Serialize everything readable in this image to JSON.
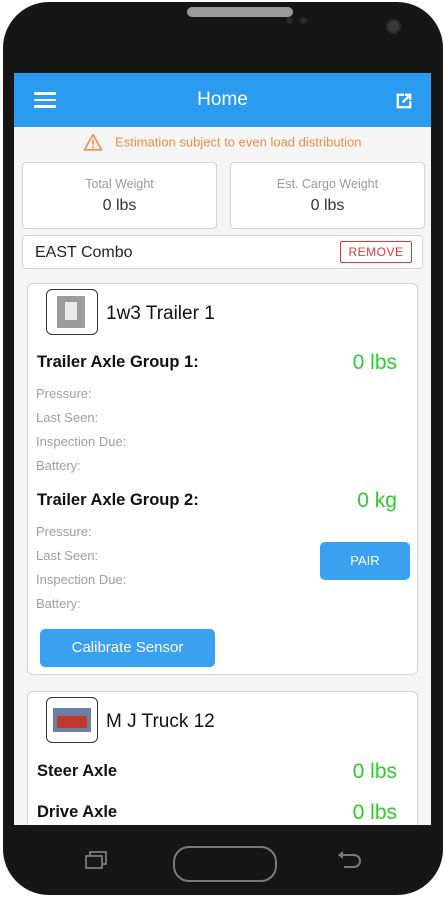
{
  "appbar": {
    "title": "Home",
    "menu_icon": "menu-icon",
    "share_icon": "open-external-icon",
    "color": "#2b9bf0"
  },
  "notice": {
    "text": "Estimation subject to even load distribution",
    "icon": "warning-icon",
    "color": "#f08c45"
  },
  "stats": {
    "total_weight": {
      "label": "Total Weight",
      "value": "0 lbs"
    },
    "est_cargo": {
      "label": "Est. Cargo Weight",
      "value": "0 lbs"
    }
  },
  "combo": {
    "name": "EAST Combo",
    "remove_label": "REMOVE"
  },
  "trailer": {
    "name": "1w3 Trailer 1",
    "groups": [
      {
        "label": "Trailer Axle Group 1:",
        "weight": "0 lbs",
        "fields": {
          "pressure": "Pressure:",
          "last_seen": "Last Seen:",
          "inspection_due": "Inspection Due:",
          "battery": "Battery:"
        }
      },
      {
        "label": "Trailer Axle Group 2:",
        "weight": "0 kg",
        "fields": {
          "pressure": "Pressure:",
          "last_seen": "Last Seen:",
          "inspection_due": "Inspection Due:",
          "battery": "Battery:"
        }
      }
    ],
    "pair_label": "PAIR",
    "calibrate_label": "Calibrate Sensor"
  },
  "truck": {
    "name": "M J Truck 12",
    "axles": [
      {
        "label": "Steer Axle",
        "weight": "0 lbs"
      },
      {
        "label": "Drive Axle",
        "weight": "0 lbs"
      }
    ]
  },
  "accent_green": "#2dcc2d"
}
